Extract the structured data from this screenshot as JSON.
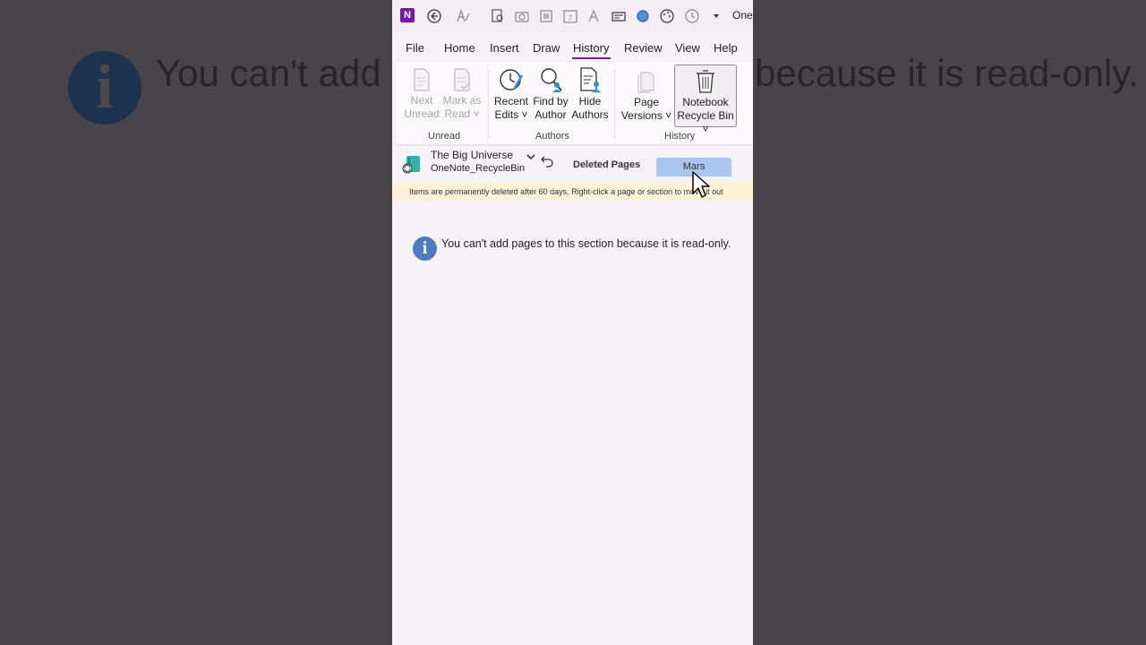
{
  "background": {
    "left_text": "You can't add",
    "right_text": "because it is read-only."
  },
  "app": {
    "name": "One",
    "logo_letter": "N"
  },
  "quick_access": {
    "icons": [
      "back-icon",
      "pen-icon",
      "search-icon",
      "camera-icon",
      "clip-icon",
      "calendar-icon",
      "font-icon",
      "keyboard-icon",
      "circle-icon",
      "palette-icon",
      "clock-icon",
      "chevron-down-icon"
    ]
  },
  "menu": {
    "items": [
      "File",
      "Home",
      "Insert",
      "Draw",
      "History",
      "Review",
      "View",
      "Help"
    ],
    "active": "History"
  },
  "ribbon": {
    "unread": {
      "label": "Unread",
      "next_line1": "Next",
      "next_line2": "Unread",
      "mark_line1": "Mark as",
      "mark_line2": "Read"
    },
    "authors": {
      "label": "Authors",
      "recent_line1": "Recent",
      "recent_line2": "Edits",
      "find_line1": "Find by",
      "find_line2": "Author",
      "hide_line1": "Hide",
      "hide_line2": "Authors"
    },
    "history": {
      "label": "History",
      "page_line1": "Page",
      "page_line2": "Versions",
      "bin_line1": "Notebook",
      "bin_line2": "Recycle Bin"
    }
  },
  "navbar": {
    "notebook_title": "The Big Universe",
    "notebook_sub": "OneNote_RecycleBin",
    "tab_deleted": "Deleted Pages",
    "tab_mars": "Mars"
  },
  "notice": "Items are permanently deleted after 60 days. Right-click a page or section to move it out",
  "message": "You can't add pages to this section because it is read-only.",
  "colors": {
    "accent": "#7719aa",
    "tab_selected": "#a7c5ef",
    "notice_bg": "#fdf3d4",
    "info_blue": "#4f7cc0"
  }
}
